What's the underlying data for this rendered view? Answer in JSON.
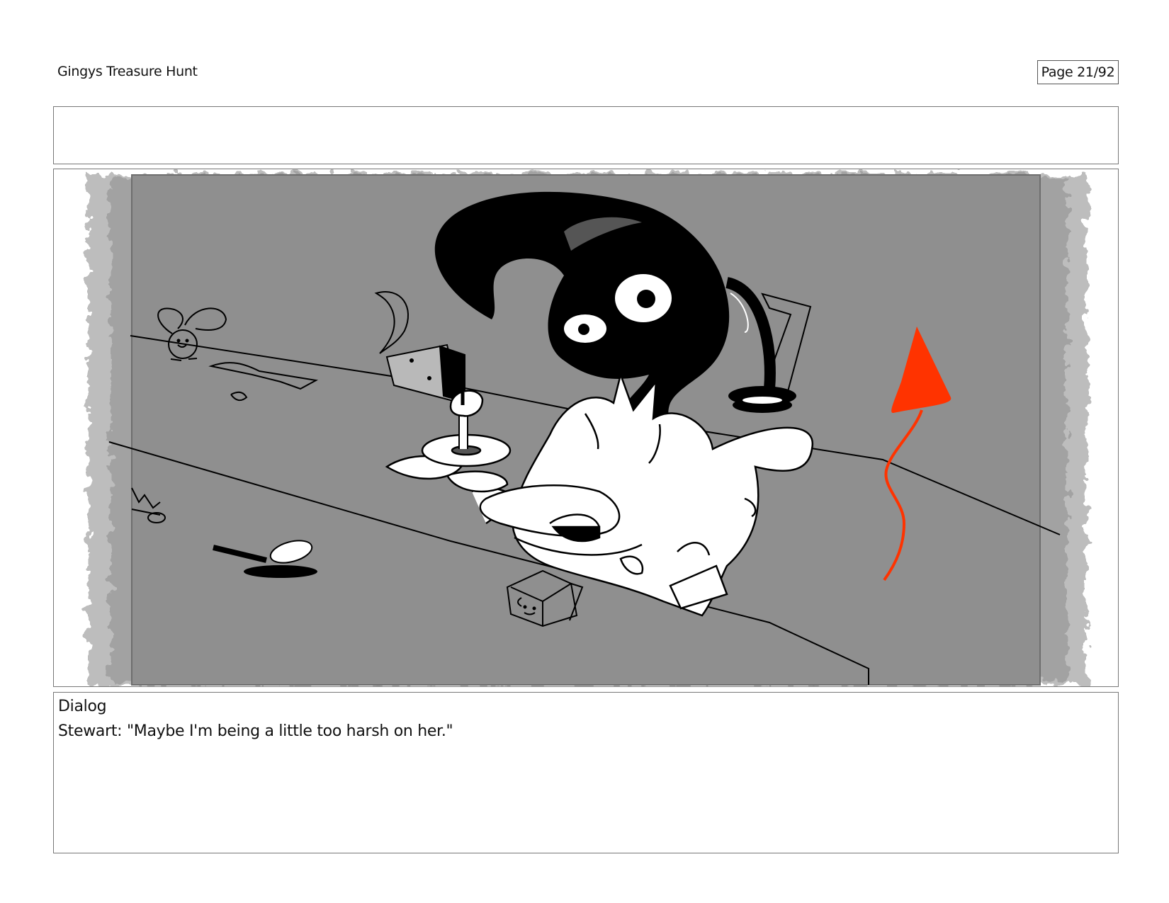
{
  "header": {
    "title": "Gingys Treasure Hunt",
    "page_label": "Page 21/92"
  },
  "panel": {
    "artwork": "storyboard-sketch",
    "colors": {
      "background": "#8f8f8f",
      "vignette": "#cfcfcf",
      "ink": "#000000",
      "accent": "#ff3300"
    }
  },
  "dialog": {
    "heading": "Dialog",
    "line": "Stewart: \"Maybe I'm being a little too harsh on her.\""
  }
}
